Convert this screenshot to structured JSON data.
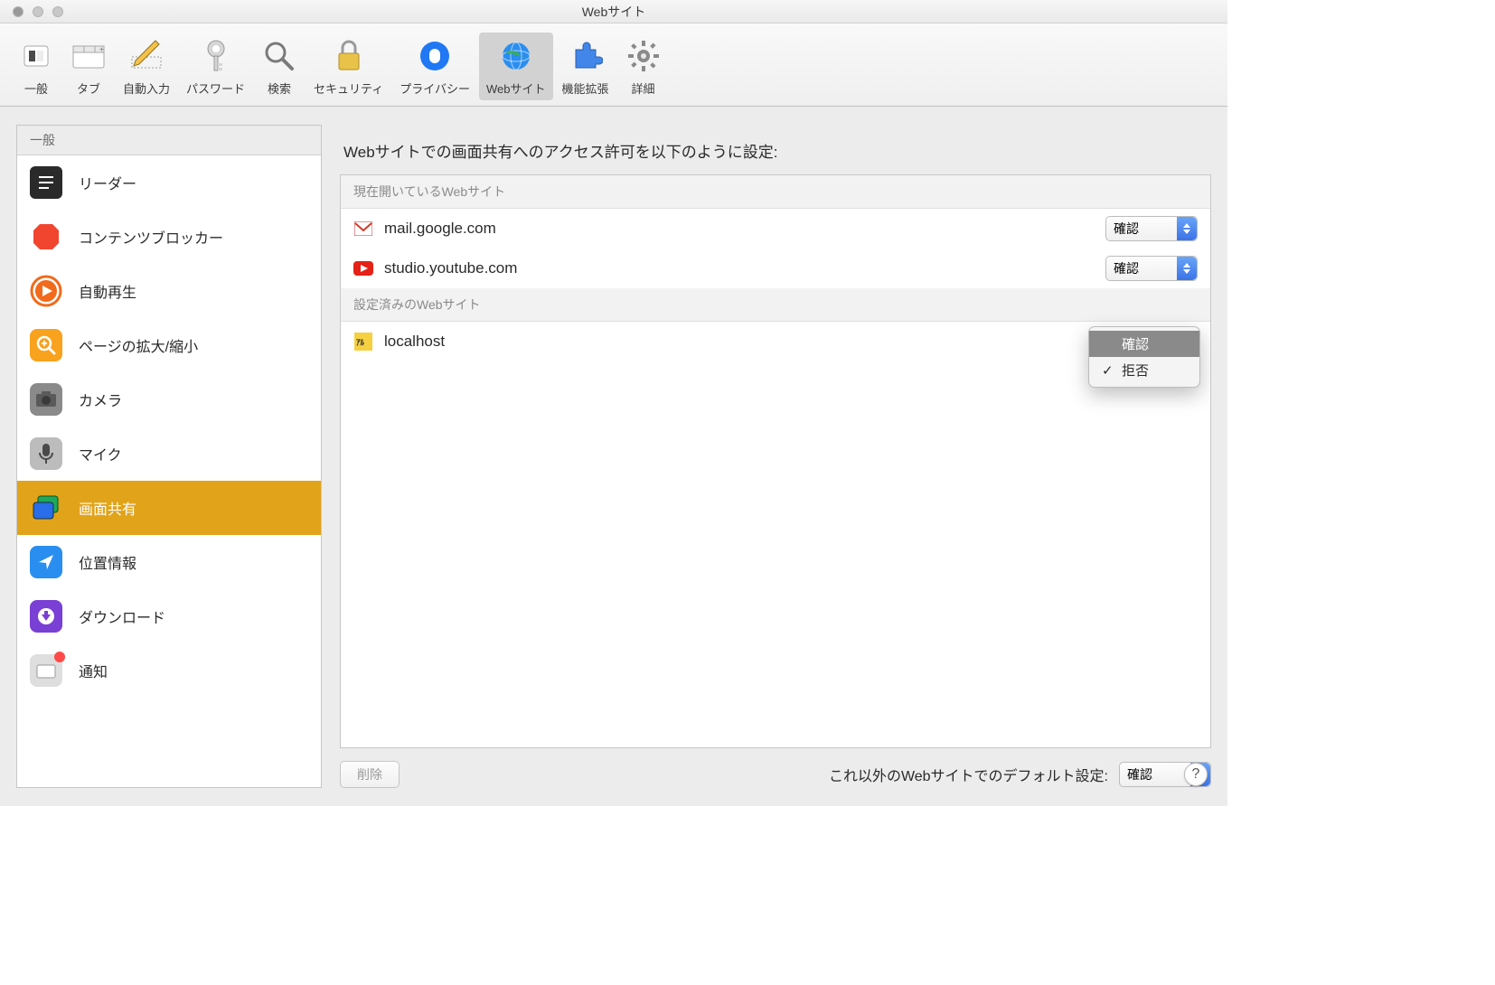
{
  "window": {
    "title": "Webサイト"
  },
  "toolbar": [
    {
      "label": "一般",
      "icon": "general"
    },
    {
      "label": "タブ",
      "icon": "tabs"
    },
    {
      "label": "自動入力",
      "icon": "autofill"
    },
    {
      "label": "パスワード",
      "icon": "passwords"
    },
    {
      "label": "検索",
      "icon": "search"
    },
    {
      "label": "セキュリティ",
      "icon": "security"
    },
    {
      "label": "プライバシー",
      "icon": "privacy"
    },
    {
      "label": "Webサイト",
      "icon": "websites",
      "active": true
    },
    {
      "label": "機能拡張",
      "icon": "extensions"
    },
    {
      "label": "詳細",
      "icon": "advanced"
    }
  ],
  "sidebar": {
    "header": "一般",
    "items": [
      {
        "label": "リーダー",
        "icon": "reader"
      },
      {
        "label": "コンテンツブロッカー",
        "icon": "blocker"
      },
      {
        "label": "自動再生",
        "icon": "autoplay"
      },
      {
        "label": "ページの拡大/縮小",
        "icon": "zoom"
      },
      {
        "label": "カメラ",
        "icon": "camera"
      },
      {
        "label": "マイク",
        "icon": "mic"
      },
      {
        "label": "画面共有",
        "icon": "screenshare",
        "selected": true
      },
      {
        "label": "位置情報",
        "icon": "location"
      },
      {
        "label": "ダウンロード",
        "icon": "download"
      },
      {
        "label": "通知",
        "icon": "notification",
        "badge": true
      }
    ]
  },
  "main": {
    "heading": "Webサイトでの画面共有へのアクセス許可を以下のように設定:",
    "sections": {
      "open": {
        "title": "現在開いているWebサイト",
        "rows": [
          {
            "site": "mail.google.com",
            "favicon": "gmail",
            "permission": "確認"
          },
          {
            "site": "studio.youtube.com",
            "favicon": "youtube",
            "permission": "確認"
          }
        ]
      },
      "configured": {
        "title": "設定済みのWebサイト",
        "rows": [
          {
            "site": "localhost",
            "favicon": "local",
            "permission": "拒否",
            "menu_open": true
          }
        ]
      }
    },
    "dropdown": {
      "options": [
        "確認",
        "拒否"
      ],
      "highlighted": "確認",
      "checked": "拒否"
    },
    "delete_button": "削除",
    "default_label": "これ以外のWebサイトでのデフォルト設定:",
    "default_permission": "確認"
  }
}
